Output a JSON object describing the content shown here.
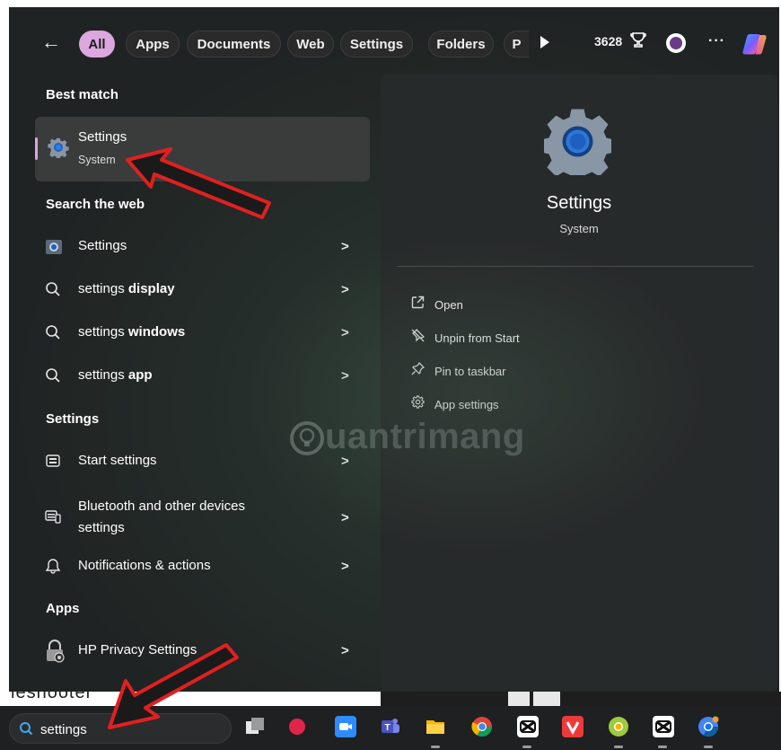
{
  "filters": {
    "back_label": "←",
    "tabs": [
      {
        "label": "All",
        "active": true
      },
      {
        "label": "Apps",
        "active": false
      },
      {
        "label": "Documents",
        "active": false
      },
      {
        "label": "Web",
        "active": false
      },
      {
        "label": "Settings",
        "active": false
      },
      {
        "label": "Folders",
        "active": false
      },
      {
        "label": "P",
        "active": false
      }
    ],
    "points": "3628",
    "more_label": "···"
  },
  "best_match": {
    "heading": "Best match",
    "title": "Settings",
    "subtitle": "System"
  },
  "web": {
    "heading": "Search the web",
    "items": [
      {
        "plain": "Settings",
        "bold": ""
      },
      {
        "plain": "settings ",
        "bold": "display"
      },
      {
        "plain": "settings ",
        "bold": "windows"
      },
      {
        "plain": "settings ",
        "bold": "app"
      }
    ]
  },
  "settings_section": {
    "heading": "Settings",
    "items": [
      {
        "label": "Start settings"
      },
      {
        "label": "Bluetooth and other devices settings",
        "line1": "Bluetooth and other devices",
        "line2": "settings"
      },
      {
        "label": "Notifications & actions"
      }
    ]
  },
  "apps_section": {
    "heading": "Apps",
    "items": [
      {
        "label": "HP Privacy Settings"
      }
    ]
  },
  "detail": {
    "title": "Settings",
    "subtitle": "System",
    "actions": [
      {
        "label": "Open",
        "icon": "open-external-icon"
      },
      {
        "label": "Unpin from Start",
        "icon": "unpin-icon"
      },
      {
        "label": "Pin to taskbar",
        "icon": "pin-icon"
      },
      {
        "label": "App settings",
        "icon": "gear-icon"
      }
    ]
  },
  "watermark": "uantrimang",
  "background_text": "leshooter",
  "taskbar": {
    "search_value": "settings",
    "apps": [
      "task-view-icon",
      "record-icon",
      "zoom-icon",
      "teams-icon",
      "file-explorer-icon",
      "chrome-icon",
      "capcut-icon",
      "vivaldi-icon",
      "chrome-canary-icon",
      "capcut-icon",
      "chrome-dev-icon"
    ]
  },
  "colors": {
    "accent": "#dca7df",
    "arrow": "#e02020",
    "panel": "#202323"
  }
}
